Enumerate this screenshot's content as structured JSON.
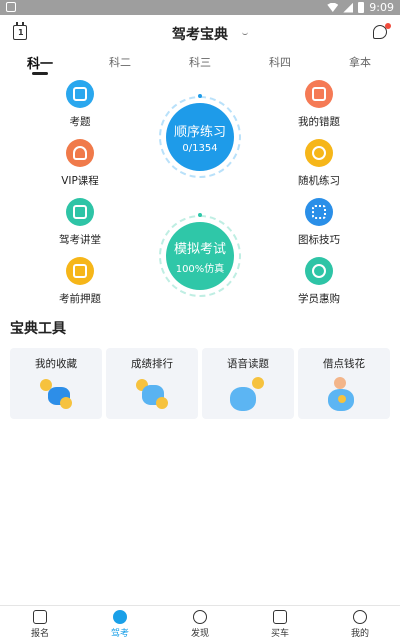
{
  "status_bar": {
    "time": "9:09"
  },
  "header": {
    "title": "驾考宝典"
  },
  "tabs": [
    {
      "label": "科一",
      "active": true
    },
    {
      "label": "科二",
      "active": false
    },
    {
      "label": "科三",
      "active": false
    },
    {
      "label": "科四",
      "active": false
    },
    {
      "label": "拿本",
      "active": false
    }
  ],
  "features_left": [
    {
      "label": "考题",
      "icon": "exam-icon",
      "color": "#2aa7ee"
    },
    {
      "label": "VIP课程",
      "icon": "vip-icon",
      "color": "#f07a4a"
    },
    {
      "label": "驾考讲堂",
      "icon": "lecture-icon",
      "color": "#2ec4a6"
    },
    {
      "label": "考前押题",
      "icon": "predict-icon",
      "color": "#f6b619"
    }
  ],
  "features_right": [
    {
      "label": "我的错题",
      "icon": "mistakes-icon",
      "color": "#f57a55"
    },
    {
      "label": "随机练习",
      "icon": "random-icon",
      "color": "#f6b619"
    },
    {
      "label": "图标技巧",
      "icon": "tips-icon",
      "color": "#2a8fe8"
    },
    {
      "label": "学员惠购",
      "icon": "discount-icon",
      "color": "#2ec4a6"
    }
  ],
  "practice": {
    "title": "顺序练习",
    "progress": "0/1354",
    "color": "#1e9be9"
  },
  "mock": {
    "title": "模拟考试",
    "subtitle": "100%仿真",
    "color": "#2fc7a8"
  },
  "tools_title": "宝典工具",
  "tools": [
    {
      "label": "我的收藏"
    },
    {
      "label": "成绩排行"
    },
    {
      "label": "语音读题"
    },
    {
      "label": "借点钱花"
    }
  ],
  "bottom_nav": [
    {
      "label": "报名",
      "active": false
    },
    {
      "label": "驾考",
      "active": true
    },
    {
      "label": "发现",
      "active": false
    },
    {
      "label": "买车",
      "active": false
    },
    {
      "label": "我的",
      "active": false
    }
  ],
  "accent": "#1aa0e8"
}
